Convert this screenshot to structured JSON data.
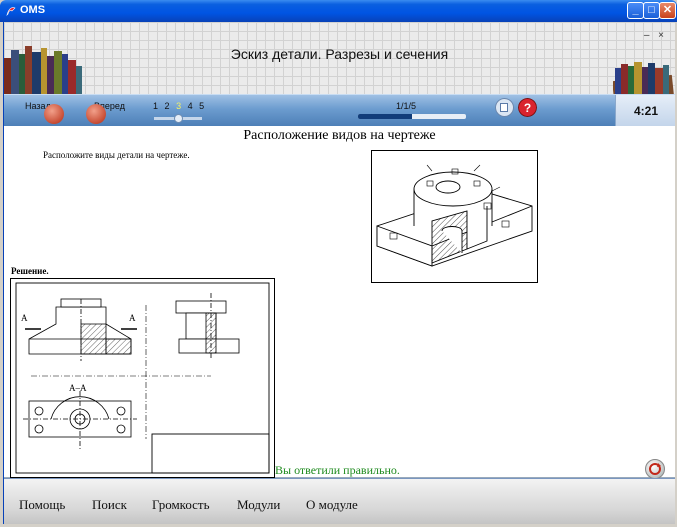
{
  "window": {
    "title": "OMS",
    "min": "_",
    "max": "□",
    "close": "✕"
  },
  "header": {
    "lesson_title": "Эскиз детали. Разрезы и сечения",
    "mini_buttons": "– ×"
  },
  "nav": {
    "back_label": "Назад",
    "forward_label": "Вперед",
    "pages": [
      "1",
      "2",
      "3",
      "4",
      "5"
    ],
    "current_page": "3",
    "progress_label": "1/1/5",
    "progress": 0.5,
    "timer": "4:21"
  },
  "content": {
    "topic": "Расположение видов на чертеже",
    "instruction": "Расположите виды детали на чертеже.",
    "solution_label": "Решение.",
    "section_label": "А–А",
    "marker_a": "А",
    "feedback": "Вы ответили правильно."
  },
  "footer": {
    "menu": [
      "Помощь",
      "Поиск",
      "Громкость",
      "Модули",
      "О модуле"
    ]
  },
  "colors": {
    "titlebar": "#0054e3",
    "nav": "#6c9ccf",
    "feedback": "#1d8a1d",
    "progress": "#123d7a"
  }
}
